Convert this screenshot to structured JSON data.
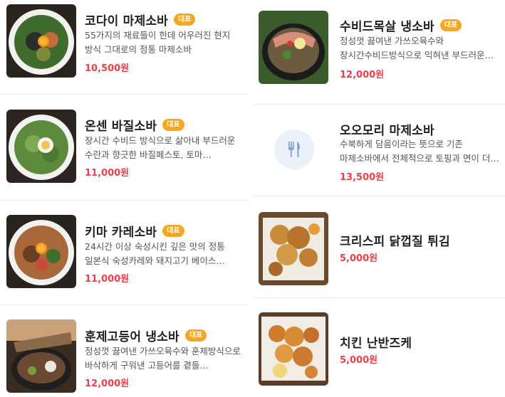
{
  "menu": {
    "badge_label": "대표",
    "left": [
      {
        "name": "코다이 마제소바",
        "badge": true,
        "description": "55가지의 재료들이 한데 어우러진 현지 방식 그대로의 정통 마제소바",
        "price": "10,500원",
        "image": "noodle-bowl-egg-yolk"
      },
      {
        "name": "온센 바질소바",
        "badge": true,
        "description": "장시간 수비드 방식으로 삶아내 부드러운 수란과 향긋한 바질페스토, 토마…",
        "price": "11,000원",
        "image": "noodle-bowl-basil-egg"
      },
      {
        "name": "키마 카레소바",
        "badge": true,
        "description": "24시간 이상 숙성시킨 깊은 맛의 정통 일본식 숙성카레와 돼지고기 베이스…",
        "price": "11,000원",
        "image": "noodle-bowl-curry"
      },
      {
        "name": "훈제고등어 냉소바",
        "badge": true,
        "description": "정성껏 끓여낸 가쓰오육수와 훈제방식으로 바삭하게 구워낸 고등어를 곁들…",
        "price": "12,000원",
        "image": "smoked-mackerel-noodle"
      }
    ],
    "right": [
      {
        "name": "수비드목살 냉소바",
        "badge": true,
        "description": "정성껏 끓여낸 가쓰오육수와 장시간수비드방식으로 익혀낸 부드러운 목살…",
        "price": "12,000원",
        "image": "pork-neck-cold-noodle"
      },
      {
        "name": "오오모리 마제소바",
        "badge": false,
        "description": "수북하게 담음이라는 뜻으로 기존 마제소바에서 전체적으로 토핑과 면이 더…",
        "price": "13,500원",
        "image": "fork-knife-icon"
      },
      {
        "name": "크리스피 닭껍질 튀김",
        "badge": false,
        "description": "",
        "price": "5,000원",
        "image": "fried-chicken-skin"
      },
      {
        "name": "치킨 난반즈케",
        "badge": false,
        "description": "",
        "price": "5,000원",
        "image": "chicken-nanban"
      }
    ]
  }
}
